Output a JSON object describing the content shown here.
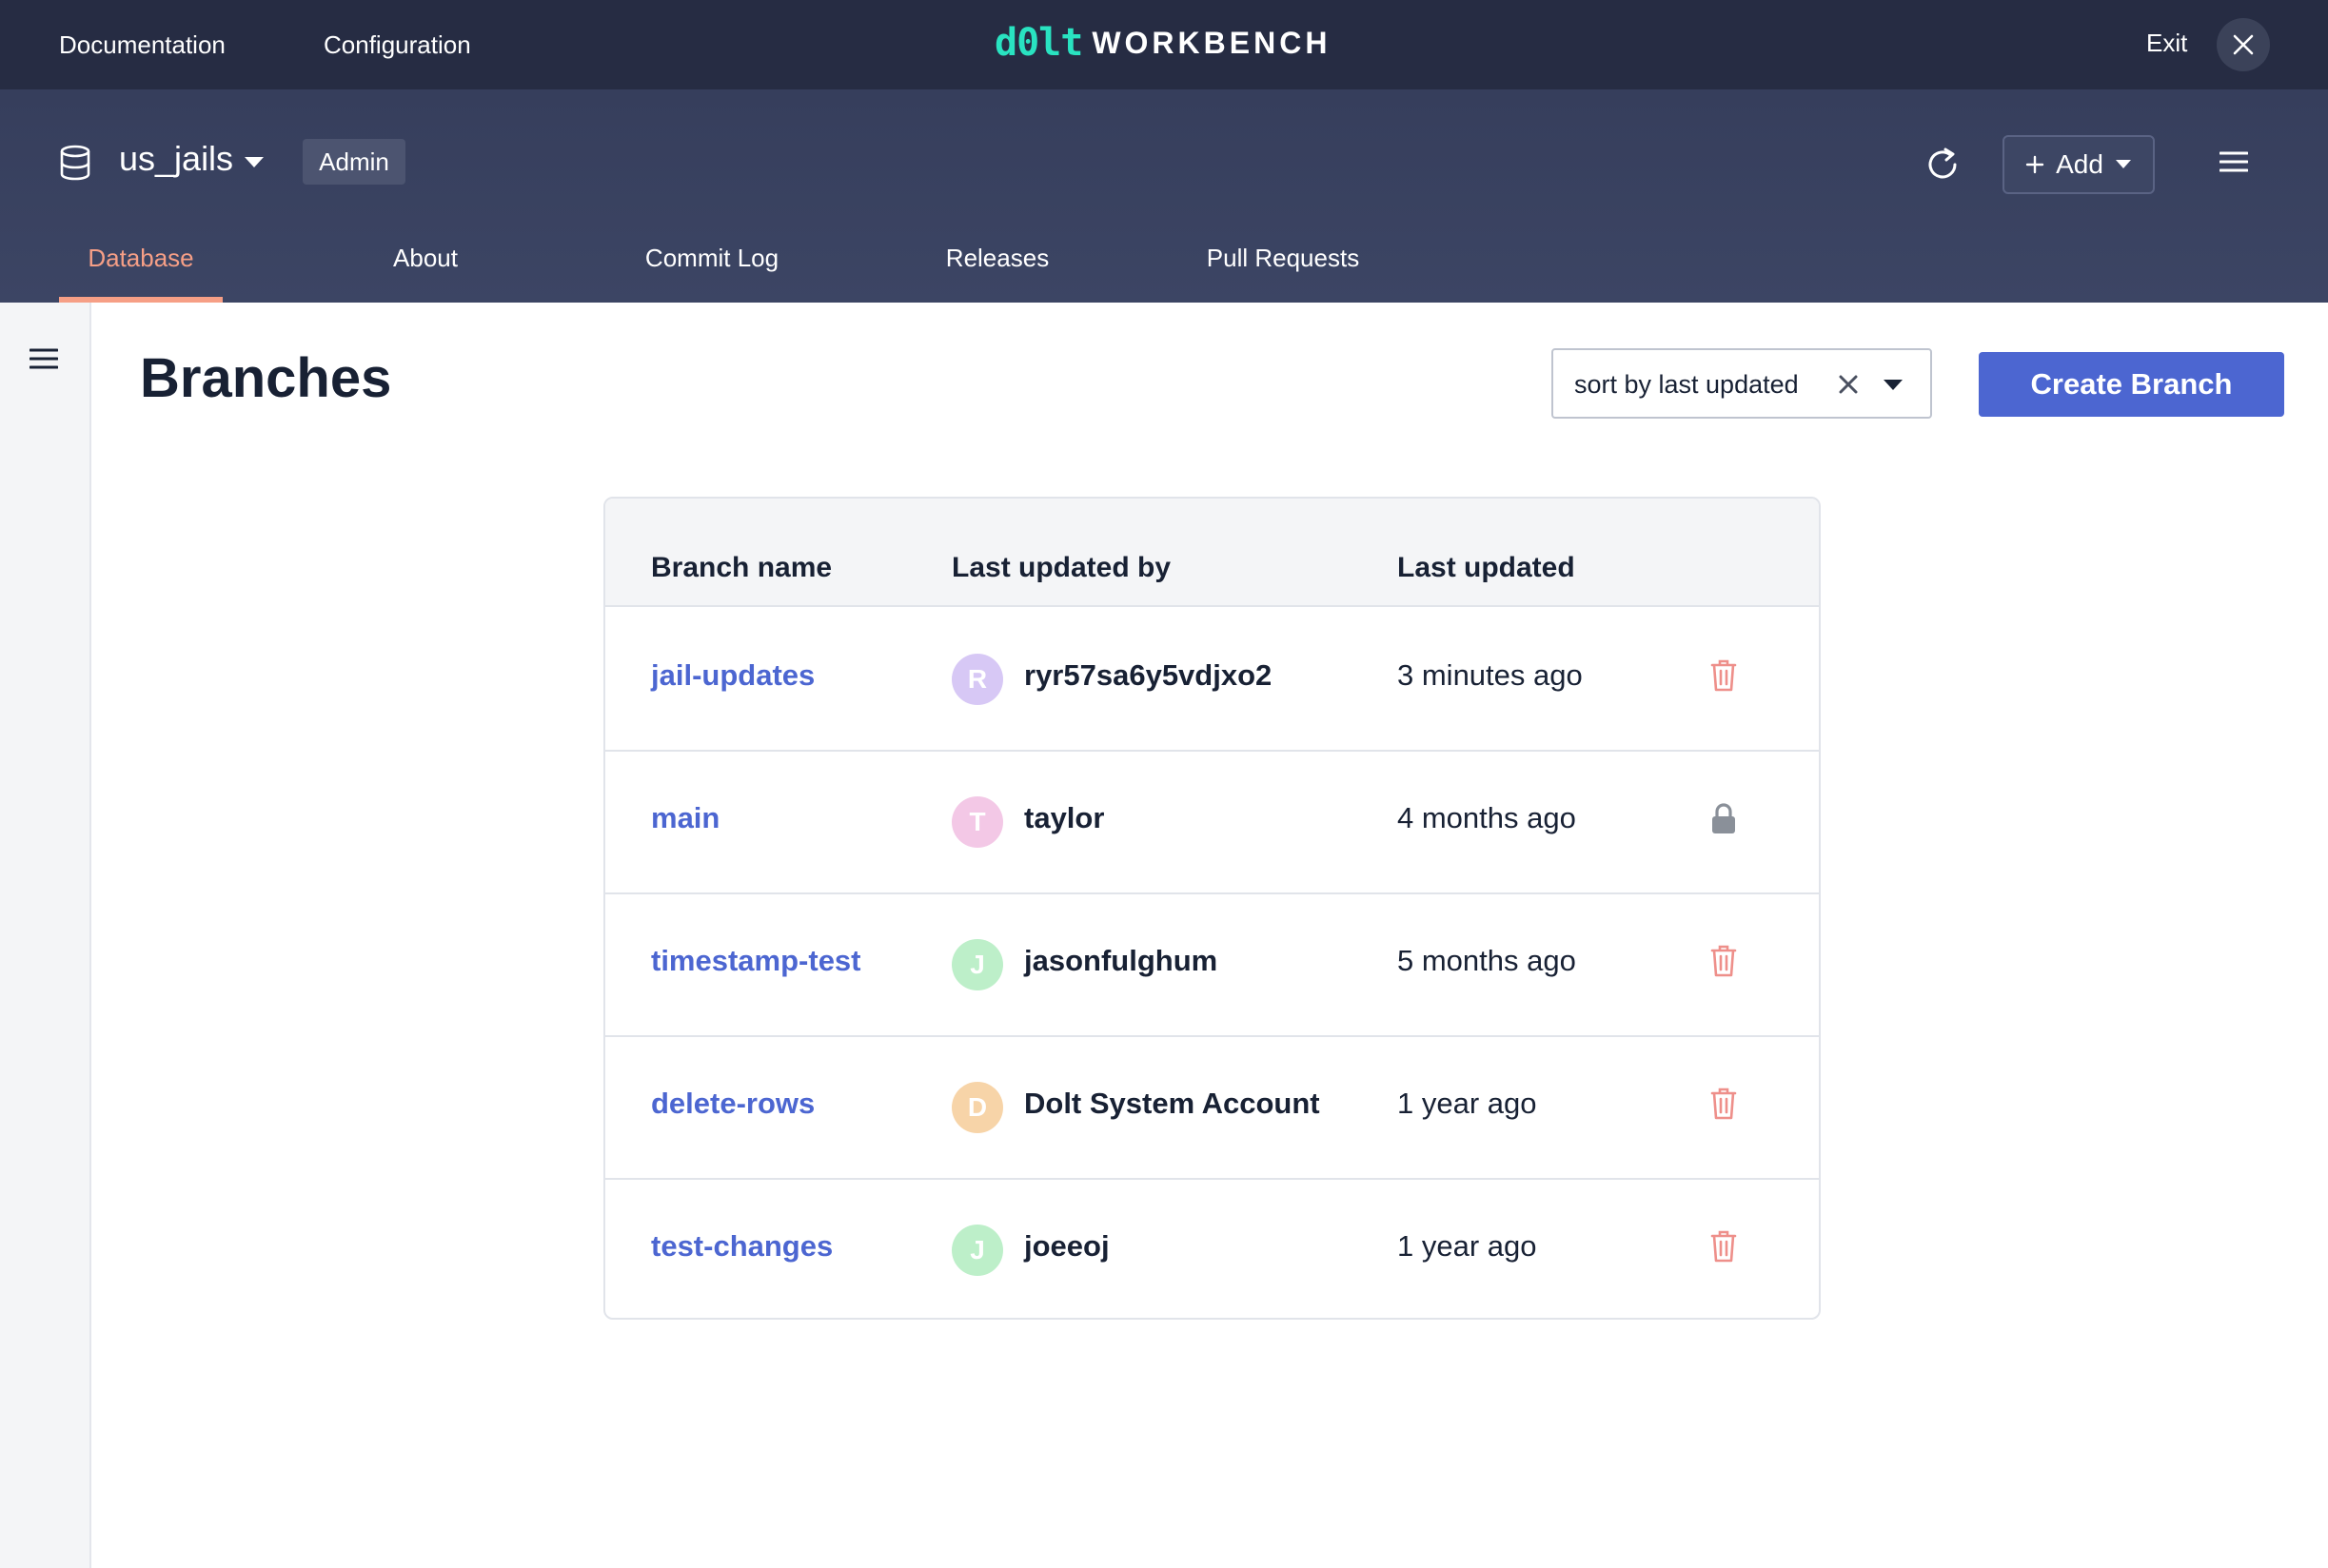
{
  "topnav": {
    "documentation": "Documentation",
    "configuration": "Configuration",
    "logo_dolt": "d0lt",
    "logo_workbench": "WORKBENCH",
    "exit": "Exit"
  },
  "database": {
    "name": "us_jails",
    "role_badge": "Admin",
    "add_label": "Add"
  },
  "tabs": [
    {
      "label": "Database",
      "active": true
    },
    {
      "label": "About",
      "active": false
    },
    {
      "label": "Commit Log",
      "active": false
    },
    {
      "label": "Releases",
      "active": false
    },
    {
      "label": "Pull Requests",
      "active": false
    }
  ],
  "main": {
    "title": "Branches",
    "sort_value": "sort by last updated",
    "create_label": "Create Branch"
  },
  "table": {
    "headers": {
      "branch": "Branch name",
      "updated_by": "Last updated by",
      "updated": "Last updated"
    },
    "rows": [
      {
        "branch": "jail-updates",
        "initial": "R",
        "avatar_color": "#d7c8f5",
        "user": "ryr57sa6y5vdjxo2",
        "time": "3 minutes ago",
        "action_icon": "trash-icon"
      },
      {
        "branch": "main",
        "initial": "T",
        "avatar_color": "#f3c8e6",
        "user": "taylor",
        "time": "4 months ago",
        "action_icon": "lock-icon"
      },
      {
        "branch": "timestamp-test",
        "initial": "J",
        "avatar_color": "#bdefc9",
        "user": "jasonfulghum",
        "time": "5 months ago",
        "action_icon": "trash-icon"
      },
      {
        "branch": "delete-rows",
        "initial": "D",
        "avatar_color": "#f7d4a8",
        "user": "Dolt System Account",
        "time": "1 year ago",
        "action_icon": "trash-icon"
      },
      {
        "branch": "test-changes",
        "initial": "J",
        "avatar_color": "#bdefc9",
        "user": "joeeoj",
        "time": "1 year ago",
        "action_icon": "trash-icon"
      }
    ]
  },
  "colors": {
    "topbar": "#262c43",
    "header": "#3a4260",
    "accent_tab": "#f69f86",
    "primary": "#4c66d1",
    "trash": "#ee8f8a",
    "lock": "#8a9099"
  }
}
